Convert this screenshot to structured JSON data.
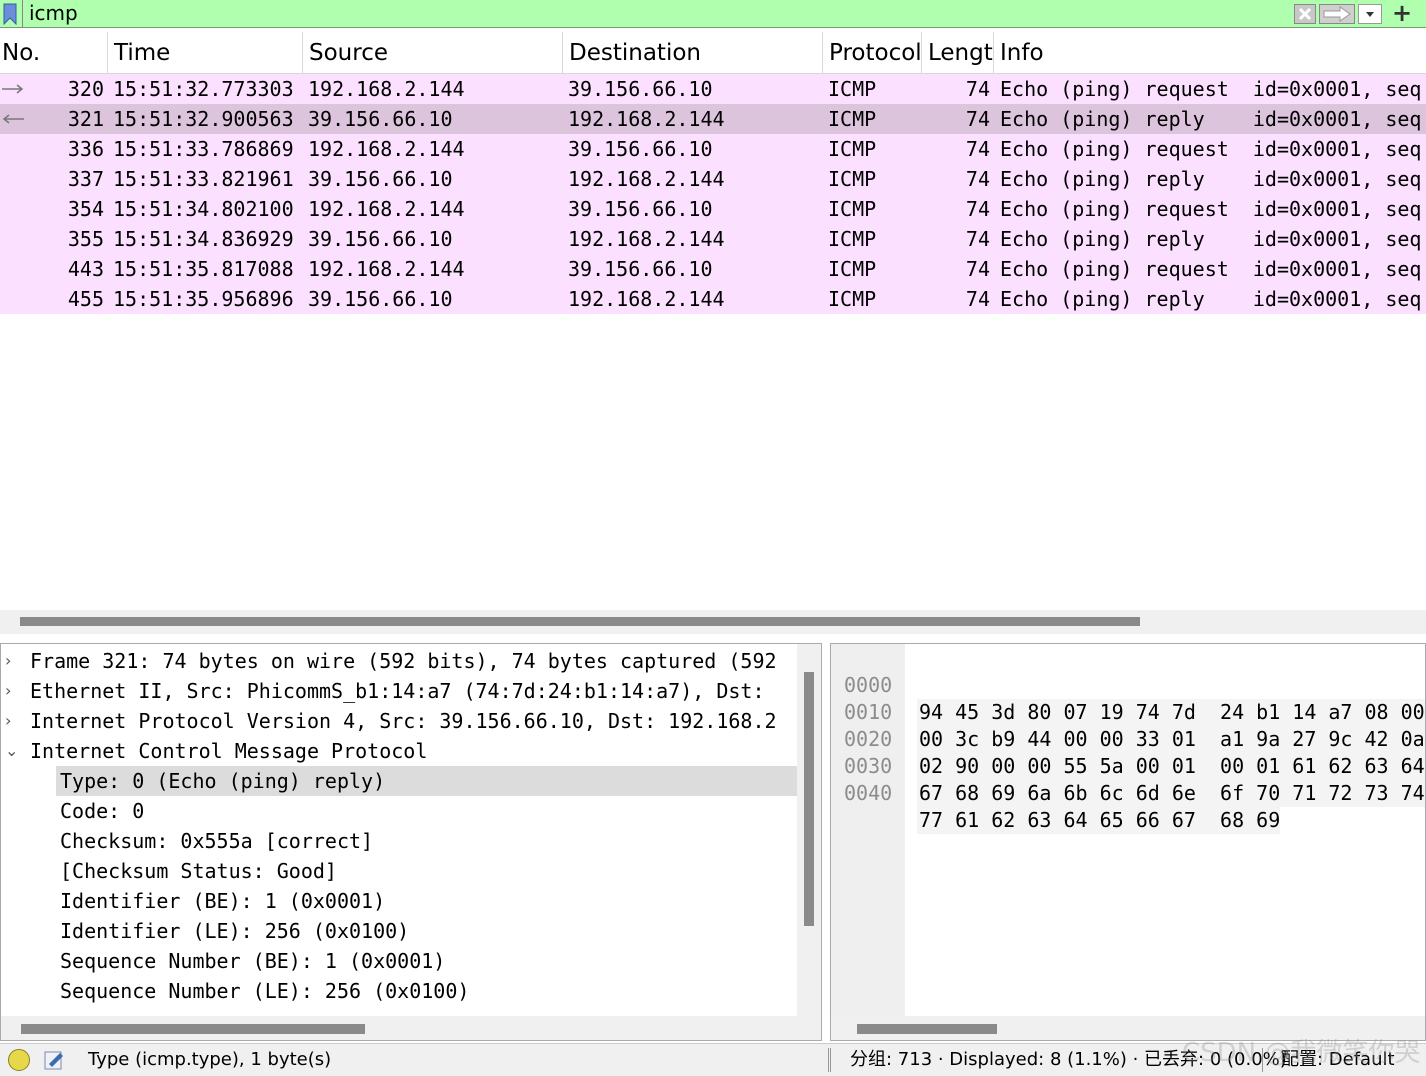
{
  "filter": {
    "value": "icmp",
    "plus_label": "+"
  },
  "columns": [
    "No.",
    "Time",
    "Source",
    "Destination",
    "Protocol",
    "Lengt",
    "Info"
  ],
  "packets": [
    {
      "no": "320",
      "time": "15:51:32.773303",
      "src": "192.168.2.144",
      "dst": "39.156.66.10",
      "proto": "ICMP",
      "len": "74",
      "info": "Echo (ping) request  id=0x0001, seq",
      "related": "request-arrow"
    },
    {
      "no": "321",
      "time": "15:51:32.900563",
      "src": "39.156.66.10",
      "dst": "192.168.2.144",
      "proto": "ICMP",
      "len": "74",
      "info": "Echo (ping) reply    id=0x0001, seq",
      "related": "reply-arrow"
    },
    {
      "no": "336",
      "time": "15:51:33.786869",
      "src": "192.168.2.144",
      "dst": "39.156.66.10",
      "proto": "ICMP",
      "len": "74",
      "info": "Echo (ping) request  id=0x0001, seq"
    },
    {
      "no": "337",
      "time": "15:51:33.821961",
      "src": "39.156.66.10",
      "dst": "192.168.2.144",
      "proto": "ICMP",
      "len": "74",
      "info": "Echo (ping) reply    id=0x0001, seq"
    },
    {
      "no": "354",
      "time": "15:51:34.802100",
      "src": "192.168.2.144",
      "dst": "39.156.66.10",
      "proto": "ICMP",
      "len": "74",
      "info": "Echo (ping) request  id=0x0001, seq"
    },
    {
      "no": "355",
      "time": "15:51:34.836929",
      "src": "39.156.66.10",
      "dst": "192.168.2.144",
      "proto": "ICMP",
      "len": "74",
      "info": "Echo (ping) reply    id=0x0001, seq"
    },
    {
      "no": "443",
      "time": "15:51:35.817088",
      "src": "192.168.2.144",
      "dst": "39.156.66.10",
      "proto": "ICMP",
      "len": "74",
      "info": "Echo (ping) request  id=0x0001, seq"
    },
    {
      "no": "455",
      "time": "15:51:35.956896",
      "src": "39.156.66.10",
      "dst": "192.168.2.144",
      "proto": "ICMP",
      "len": "74",
      "info": "Echo (ping) reply    id=0x0001, seq"
    }
  ],
  "details": [
    {
      "text": "Frame 321: 74 bytes on wire (592 bits), 74 bytes captured (592",
      "caret": "›",
      "indent": 0
    },
    {
      "text": "Ethernet II, Src: PhicommS_b1:14:a7 (74:7d:24:b1:14:a7), Dst: ",
      "caret": "›",
      "indent": 0
    },
    {
      "text": "Internet Protocol Version 4, Src: 39.156.66.10, Dst: 192.168.2",
      "caret": "›",
      "indent": 0
    },
    {
      "text": "Internet Control Message Protocol",
      "caret": "⌄",
      "indent": 0
    },
    {
      "text": "Type: 0 (Echo (ping) reply)",
      "caret": "",
      "indent": 1,
      "selected": true
    },
    {
      "text": "Code: 0",
      "caret": "",
      "indent": 1
    },
    {
      "text": "Checksum: 0x555a [correct]",
      "caret": "",
      "indent": 1
    },
    {
      "text": "[Checksum Status: Good]",
      "caret": "",
      "indent": 1
    },
    {
      "text": "Identifier (BE): 1 (0x0001)",
      "caret": "",
      "indent": 1
    },
    {
      "text": "Identifier (LE): 256 (0x0100)",
      "caret": "",
      "indent": 1
    },
    {
      "text": "Sequence Number (BE): 1 (0x0001)",
      "caret": "",
      "indent": 1
    },
    {
      "text": "Sequence Number (LE): 256 (0x0100)",
      "caret": "",
      "indent": 1
    }
  ],
  "bytes": [
    {
      "offset": "0000",
      "hex": "94 45 3d 80 07 19 74 7d  24 b1 14 a7 08 00"
    },
    {
      "offset": "0010",
      "hex": "00 3c b9 44 00 00 33 01  a1 9a 27 9c 42 0a"
    },
    {
      "offset": "0020",
      "hex": "02 90 00 00 55 5a 00 01  00 01 61 62 63 64"
    },
    {
      "offset": "0030",
      "hex": "67 68 69 6a 6b 6c 6d 6e  6f 70 71 72 73 74"
    },
    {
      "offset": "0040",
      "hex": "77 61 62 63 64 65 66 67  68 69"
    }
  ],
  "status": {
    "field": "Type (icmp.type), 1 byte(s)",
    "packets": "分组: 713 · Displayed: 8 (1.1%) · 已丢弃: 0 (0.0%)",
    "profile": "配置: Default",
    "watermark": "CSDN @我微笑你哭"
  },
  "colors": {
    "filter_valid": "#afffaf",
    "icmp_row": "#fce0ff",
    "selected_row": "#dcc4dc"
  }
}
